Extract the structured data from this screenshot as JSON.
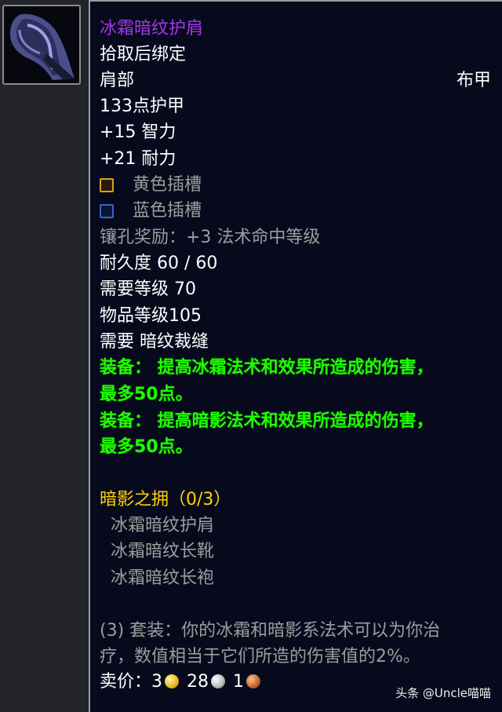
{
  "item": {
    "name": "冰霜暗纹护肩",
    "bind": "拾取后绑定",
    "slot": "肩部",
    "armor_type": "布甲",
    "armor": "133点护甲",
    "stat_int": "+15 智力",
    "stat_sta": "+21 耐力",
    "socket_yellow": "黄色插槽",
    "socket_blue": "蓝色插槽",
    "socket_bonus": "镶孔奖励：+3 法术命中等级",
    "durability": "耐久度 60 / 60",
    "req_level": "需要等级 70",
    "item_level": "物品等级105",
    "req_skill": "需要 暗纹裁缝",
    "equip1_line1": "装备： 提高冰霜法术和效果所造成的伤害，",
    "equip1_line2": "最多50点。",
    "equip2_line1": "装备： 提高暗影法术和效果所造成的伤害，",
    "equip2_line2": "最多50点。",
    "set_name": "暗影之拥（0/3）",
    "set_items": [
      "冰霜暗纹护肩",
      "冰霜暗纹长靴",
      "冰霜暗纹长袍"
    ],
    "set_bonus_line1": "(3) 套装：你的冰霜和暗影系法术可以为你治",
    "set_bonus_line2": "疗，数值相当于它们所造的伤害值的2%。",
    "sell_label": "卖价：",
    "sell_gold": "3",
    "sell_silver": "28",
    "sell_copper": "1"
  },
  "icons": {
    "item_icon": "cloth-shoulder-icon",
    "socket_yellow_icon": "yellow-socket-icon",
    "socket_blue_icon": "blue-socket-icon",
    "gold_coin": "gold-coin-icon",
    "silver_coin": "silver-coin-icon",
    "copper_coin": "copper-coin-icon"
  },
  "colors": {
    "epic_purple": "#a335ee",
    "green_effect": "#1eff00",
    "set_gold": "#ffd100",
    "gray_text": "#9d9d9d",
    "tooltip_bg": "#070a1c"
  },
  "watermark": "头条 @Uncle喵喵"
}
